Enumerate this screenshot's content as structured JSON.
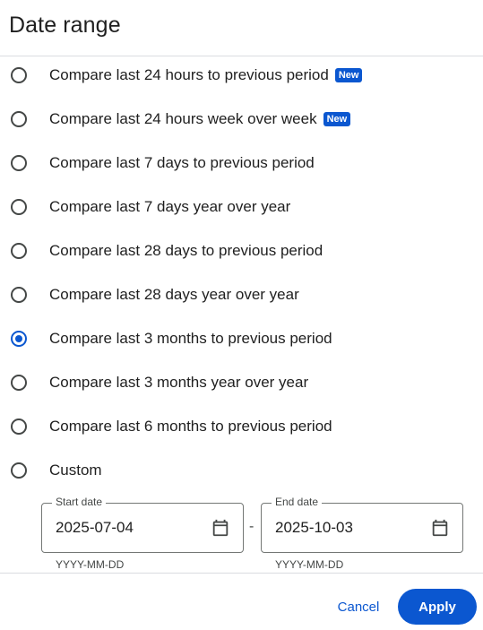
{
  "dialog": {
    "title": "Date range"
  },
  "options": [
    {
      "label": "Compare last 24 hours to previous period",
      "badge": "New",
      "selected": false
    },
    {
      "label": "Compare last 24 hours week over week",
      "badge": "New",
      "selected": false
    },
    {
      "label": "Compare last 7 days to previous period",
      "selected": false
    },
    {
      "label": "Compare last 7 days year over year",
      "selected": false
    },
    {
      "label": "Compare last 28 days to previous period",
      "selected": false
    },
    {
      "label": "Compare last 28 days year over year",
      "selected": false
    },
    {
      "label": "Compare last 3 months to previous period",
      "selected": true
    },
    {
      "label": "Compare last 3 months year over year",
      "selected": false
    },
    {
      "label": "Compare last 6 months to previous period",
      "selected": false
    },
    {
      "label": "Custom",
      "selected": false
    }
  ],
  "custom": {
    "start": {
      "label": "Start date",
      "value": "2025-07-04",
      "hint": "YYYY-MM-DD"
    },
    "separator": "-",
    "end": {
      "label": "End date",
      "value": "2025-10-03",
      "hint": "YYYY-MM-DD"
    }
  },
  "actions": {
    "cancel": "Cancel",
    "apply": "Apply"
  },
  "colors": {
    "accent": "#0b57d0",
    "text": "#1f1f1f",
    "divider": "#dadce0"
  },
  "icons": {
    "date_picker": "calendar-icon"
  }
}
